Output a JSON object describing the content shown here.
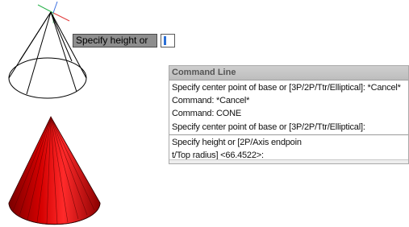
{
  "dynamic_input": {
    "prompt": "Specify height or"
  },
  "command_line": {
    "title": "Command Line",
    "history": [
      "Specify center point of base or [3P/2P/Ttr/Elliptical]: *Cancel*",
      "Command: *Cancel*",
      "Command: CONE",
      "Specify center point of base or [3P/2P/Ttr/Elliptical]:"
    ],
    "current": [
      "Specify height or [2P/Axis endpoin",
      "t/Top radius] <66.4522>:"
    ]
  },
  "colors": {
    "cone_fill": "#d40000",
    "wire": "#000000",
    "axis_x": "#e23a3a",
    "axis_y": "#2bb24c",
    "axis_z": "#3b6fe0"
  }
}
